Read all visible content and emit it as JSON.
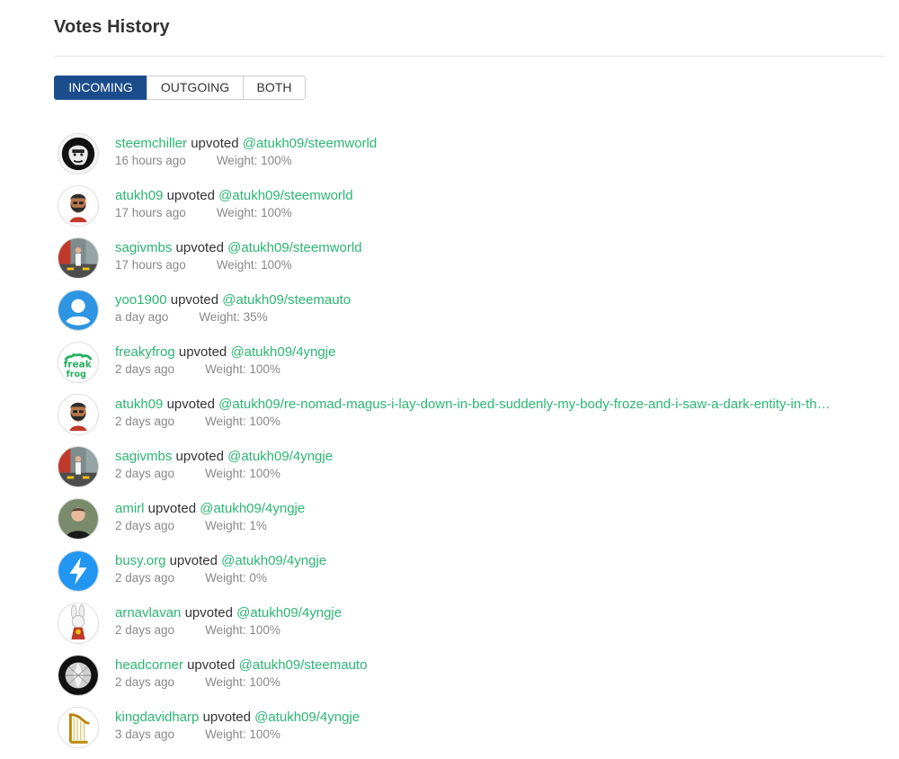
{
  "page": {
    "title": "Votes History"
  },
  "tabs": [
    {
      "label": "INCOMING",
      "active": true
    },
    {
      "label": "OUTGOING",
      "active": false
    },
    {
      "label": "BOTH",
      "active": false
    }
  ],
  "verb": "upvoted",
  "votes": [
    {
      "voter": "steemchiller",
      "post": "@atukh09/steemworld",
      "time": "16 hours ago",
      "weight": "Weight: 100%",
      "avatar_icon": "bw-portrait-avatar"
    },
    {
      "voter": "atukh09",
      "post": "@atukh09/steemworld",
      "time": "17 hours ago",
      "weight": "Weight: 100%",
      "avatar_icon": "bearded-man-avatar"
    },
    {
      "voter": "sagivmbs",
      "post": "@atukh09/steemworld",
      "time": "17 hours ago",
      "weight": "Weight: 100%",
      "avatar_icon": "street-photo-avatar"
    },
    {
      "voter": "yoo1900",
      "post": "@atukh09/steemauto",
      "time": "a day ago",
      "weight": "Weight: 35%",
      "avatar_icon": "default-user-avatar"
    },
    {
      "voter": "freakyfrog",
      "post": "@atukh09/4yngje",
      "time": "2 days ago",
      "weight": "Weight: 100%",
      "avatar_icon": "freakyfrog-logo-avatar"
    },
    {
      "voter": "atukh09",
      "post": "@atukh09/re-nomad-magus-i-lay-down-in-bed-suddenly-my-body-froze-and-i-saw-a-dark-entity-in-th…",
      "time": "2 days ago",
      "weight": "Weight: 100%",
      "avatar_icon": "bearded-man-avatar"
    },
    {
      "voter": "sagivmbs",
      "post": "@atukh09/4yngje",
      "time": "2 days ago",
      "weight": "Weight: 100%",
      "avatar_icon": "street-photo-avatar"
    },
    {
      "voter": "amirl",
      "post": "@atukh09/4yngje",
      "time": "2 days ago",
      "weight": "Weight: 1%",
      "avatar_icon": "man-portrait-avatar"
    },
    {
      "voter": "busy.org",
      "post": "@atukh09/4yngje",
      "time": "2 days ago",
      "weight": "Weight: 0%",
      "avatar_icon": "lightning-bolt-avatar"
    },
    {
      "voter": "arnavlavan",
      "post": "@atukh09/4yngje",
      "time": "2 days ago",
      "weight": "Weight: 100%",
      "avatar_icon": "white-rabbit-avatar"
    },
    {
      "voter": "headcorner",
      "post": "@atukh09/steemauto",
      "time": "2 days ago",
      "weight": "Weight: 100%",
      "avatar_icon": "diamond-avatar"
    },
    {
      "voter": "kingdavidharp",
      "post": "@atukh09/4yngje",
      "time": "3 days ago",
      "weight": "Weight: 100%",
      "avatar_icon": "harp-avatar"
    }
  ],
  "colors": {
    "accent_link": "#2bb673",
    "active_tab": "#1b4d8c",
    "muted_text": "#888888"
  }
}
